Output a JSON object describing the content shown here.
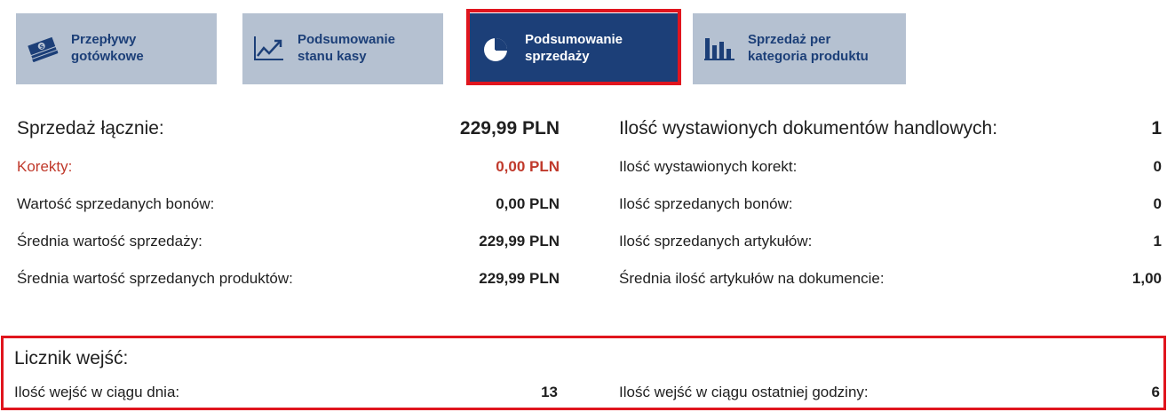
{
  "tabs": [
    {
      "line1": "Przepływy",
      "line2": "gotówkowe",
      "icon": "money-icon",
      "active": false
    },
    {
      "line1": "Podsumowanie",
      "line2": "stanu kasy",
      "icon": "line-chart-icon",
      "active": false
    },
    {
      "line1": "Podsumowanie",
      "line2": "sprzedaży",
      "icon": "pie-chart-icon",
      "active": true
    },
    {
      "line1": "Sprzedaż per",
      "line2": "kategoria produktu",
      "icon": "bar-chart-icon",
      "active": false
    }
  ],
  "sales": {
    "total_label": "Sprzedaż łącznie:",
    "total_value": "229,99 PLN",
    "corrections_label": "Korekty:",
    "corrections_value": "0,00 PLN",
    "vouchers_label": "Wartość sprzedanych bonów:",
    "vouchers_value": "0,00 PLN",
    "avg_sale_label": "Średnia wartość sprzedaży:",
    "avg_sale_value": "229,99 PLN",
    "avg_products_label": "Średnia wartość sprzedanych produktów:",
    "avg_products_value": "229,99 PLN"
  },
  "counts": {
    "docs_label": "Ilość wystawionych dokumentów handlowych:",
    "docs_value": "1",
    "corrections_label": "Ilość wystawionych korekt:",
    "corrections_value": "0",
    "vouchers_label": "Ilość sprzedanych bonów:",
    "vouchers_value": "0",
    "articles_label": "Ilość sprzedanych artykułów:",
    "articles_value": "1",
    "avg_articles_label": "Średnia ilość artykułów na dokumencie:",
    "avg_articles_value": "1,00"
  },
  "entry_counter": {
    "title": "Licznik wejść:",
    "day_label": "Ilość wejść w ciągu dnia:",
    "day_value": "13",
    "hour_label": "Ilość wejść w ciągu ostatniej godziny:",
    "hour_value": "6"
  },
  "colors": {
    "tab_inactive": "#b5c1d1",
    "tab_active": "#1c3f78",
    "highlight": "#e0151e",
    "correction_red": "#c0392b"
  }
}
